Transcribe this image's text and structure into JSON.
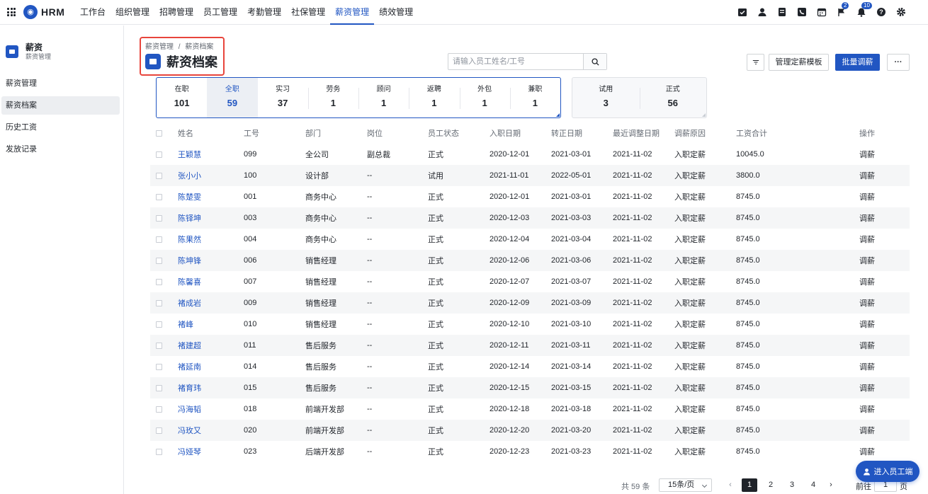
{
  "app": {
    "name": "HRM"
  },
  "nav": [
    "工作台",
    "组织管理",
    "招聘管理",
    "员工管理",
    "考勤管理",
    "社保管理",
    "薪资管理",
    "绩效管理"
  ],
  "nav_active": 6,
  "badges": {
    "flag": "2",
    "bell": "10"
  },
  "sidebar": {
    "title": "薪资",
    "subtitle": "薪资管理",
    "items": [
      {
        "label": "薪资管理"
      },
      {
        "label": "薪资档案"
      },
      {
        "label": "历史工资"
      },
      {
        "label": "发放记录"
      }
    ],
    "active": 1
  },
  "breadcrumb": {
    "parent": "薪资管理",
    "sep": "/",
    "current": "薪资档案"
  },
  "page_title": "薪资档案",
  "search": {
    "placeholder": "请输入员工姓名/工号"
  },
  "buttons": {
    "manage_template": "管理定薪模板",
    "batch_adjust": "批量调薪",
    "more": "···"
  },
  "stats_main": [
    {
      "label": "在职",
      "value": "101"
    },
    {
      "label": "全职",
      "value": "59"
    },
    {
      "label": "实习",
      "value": "37"
    },
    {
      "label": "劳务",
      "value": "1"
    },
    {
      "label": "顾问",
      "value": "1"
    },
    {
      "label": "返聘",
      "value": "1"
    },
    {
      "label": "外包",
      "value": "1"
    },
    {
      "label": "兼职",
      "value": "1"
    }
  ],
  "stats_main_active": 1,
  "stats_status": [
    {
      "label": "试用",
      "value": "3"
    },
    {
      "label": "正式",
      "value": "56"
    }
  ],
  "table": {
    "headers": [
      "姓名",
      "工号",
      "部门",
      "岗位",
      "员工状态",
      "入职日期",
      "转正日期",
      "最近调整日期",
      "调薪原因",
      "工资合计",
      "操作"
    ],
    "rows": [
      [
        "王颖慧",
        "099",
        "全公司",
        "副总裁",
        "正式",
        "2020-12-01",
        "2021-03-01",
        "2021-11-02",
        "入职定薪",
        "10045.0",
        "调薪"
      ],
      [
        "张小小",
        "100",
        "设计部",
        "--",
        "试用",
        "2021-11-01",
        "2022-05-01",
        "2021-11-02",
        "入职定薪",
        "3800.0",
        "调薪"
      ],
      [
        "陈楚雯",
        "001",
        "商务中心",
        "--",
        "正式",
        "2020-12-01",
        "2021-03-01",
        "2021-11-02",
        "入职定薪",
        "8745.0",
        "调薪"
      ],
      [
        "陈铎坤",
        "003",
        "商务中心",
        "--",
        "正式",
        "2020-12-03",
        "2021-03-03",
        "2021-11-02",
        "入职定薪",
        "8745.0",
        "调薪"
      ],
      [
        "陈果然",
        "004",
        "商务中心",
        "--",
        "正式",
        "2020-12-04",
        "2021-03-04",
        "2021-11-02",
        "入职定薪",
        "8745.0",
        "调薪"
      ],
      [
        "陈坤锋",
        "006",
        "销售经理",
        "--",
        "正式",
        "2020-12-06",
        "2021-03-06",
        "2021-11-02",
        "入职定薪",
        "8745.0",
        "调薪"
      ],
      [
        "陈馨喜",
        "007",
        "销售经理",
        "--",
        "正式",
        "2020-12-07",
        "2021-03-07",
        "2021-11-02",
        "入职定薪",
        "8745.0",
        "调薪"
      ],
      [
        "褚成岩",
        "009",
        "销售经理",
        "--",
        "正式",
        "2020-12-09",
        "2021-03-09",
        "2021-11-02",
        "入职定薪",
        "8745.0",
        "调薪"
      ],
      [
        "褚峰",
        "010",
        "销售经理",
        "--",
        "正式",
        "2020-12-10",
        "2021-03-10",
        "2021-11-02",
        "入职定薪",
        "8745.0",
        "调薪"
      ],
      [
        "褚建超",
        "011",
        "售后服务",
        "--",
        "正式",
        "2020-12-11",
        "2021-03-11",
        "2021-11-02",
        "入职定薪",
        "8745.0",
        "调薪"
      ],
      [
        "褚延南",
        "014",
        "售后服务",
        "--",
        "正式",
        "2020-12-14",
        "2021-03-14",
        "2021-11-02",
        "入职定薪",
        "8745.0",
        "调薪"
      ],
      [
        "褚育玮",
        "015",
        "售后服务",
        "--",
        "正式",
        "2020-12-15",
        "2021-03-15",
        "2021-11-02",
        "入职定薪",
        "8745.0",
        "调薪"
      ],
      [
        "冯海韬",
        "018",
        "前端开发部",
        "--",
        "正式",
        "2020-12-18",
        "2021-03-18",
        "2021-11-02",
        "入职定薪",
        "8745.0",
        "调薪"
      ],
      [
        "冯玫又",
        "020",
        "前端开发部",
        "--",
        "正式",
        "2020-12-20",
        "2021-03-20",
        "2021-11-02",
        "入职定薪",
        "8745.0",
        "调薪"
      ],
      [
        "冯娅琴",
        "023",
        "后端开发部",
        "--",
        "正式",
        "2020-12-23",
        "2021-03-23",
        "2021-11-02",
        "入职定薪",
        "8745.0",
        "调薪"
      ]
    ]
  },
  "pagination": {
    "total_text": "共 59 条",
    "page_size": "15条/页",
    "pages": [
      "1",
      "2",
      "3",
      "4"
    ],
    "current": "1",
    "goto_label": "前往",
    "goto_value": "1",
    "goto_unit": "页"
  },
  "float_button": "进入员工端",
  "colors": {
    "accent": "#2156c2",
    "highlight_border": "#e8453c"
  }
}
